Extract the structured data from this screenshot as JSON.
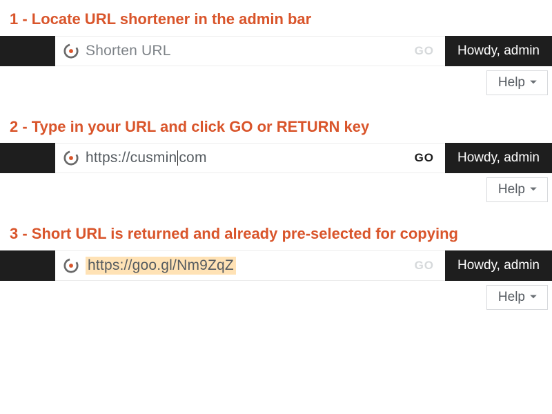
{
  "captions": {
    "step1": "1 - Locate URL shortener in the admin bar",
    "step2": "2 - Type in your URL and click GO or RETURN key",
    "step3": "3 - Short URL is returned and already pre-selected for copying"
  },
  "adminbar": {
    "howdy": "Howdy, admin",
    "help": "Help",
    "go": "GO"
  },
  "url_field": {
    "placeholder": "Shorten URL",
    "typed_before_cursor": "https://cusmin",
    "typed_after_cursor": "com",
    "result": "https://goo.gl/Nm9ZqZ"
  },
  "colors": {
    "accent": "#d9552b",
    "dark": "#1e1e1e",
    "selection": "#ffe2b5"
  }
}
